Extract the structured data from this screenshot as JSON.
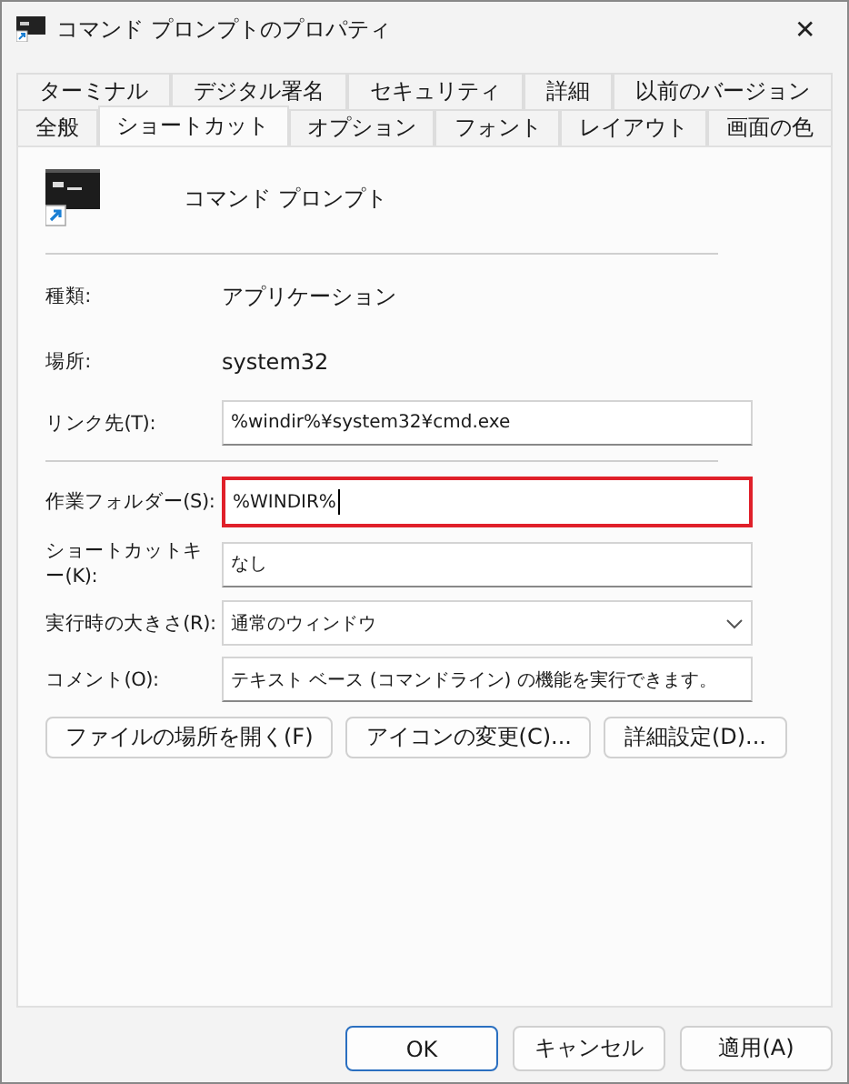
{
  "window": {
    "title": "コマンド プロンプトのプロパティ",
    "close": "✕"
  },
  "tab_rows": [
    [
      {
        "label": "ターミナル",
        "selected": false
      },
      {
        "label": "デジタル署名",
        "selected": false
      },
      {
        "label": "セキュリティ",
        "selected": false
      },
      {
        "label": "詳細",
        "selected": false
      },
      {
        "label": "以前のバージョン",
        "selected": false
      }
    ],
    [
      {
        "label": "全般",
        "selected": false
      },
      {
        "label": "ショートカット",
        "selected": true
      },
      {
        "label": "オプション",
        "selected": false
      },
      {
        "label": "フォント",
        "selected": false
      },
      {
        "label": "レイアウト",
        "selected": false
      },
      {
        "label": "画面の色",
        "selected": false
      }
    ]
  ],
  "shortcut_name": "コマンド プロンプト",
  "sections": [
    [
      {
        "kind": "info",
        "label": "種類:",
        "value": "アプリケーション"
      },
      {
        "kind": "info",
        "label": "場所:",
        "value": "system32"
      },
      {
        "kind": "text",
        "label": "リンク先(T):",
        "value": "%windir%¥system32¥cmd.exe",
        "focused": false
      }
    ],
    [
      {
        "kind": "text",
        "label": "作業フォルダー(S):",
        "value": "%WINDIR%",
        "focused": true
      },
      {
        "kind": "text",
        "label": "ショートカットキー(K):",
        "value": "なし",
        "focused": false
      },
      {
        "kind": "dropdown",
        "label": "実行時の大きさ(R):",
        "value": "通常のウィンドウ"
      },
      {
        "kind": "text",
        "label": "コメント(O):",
        "value": "テキスト ベース (コマンドライン) の機能を実行できます。",
        "focused": false
      }
    ]
  ],
  "action_buttons": [
    "ファイルの場所を開く(F)",
    "アイコンの変更(C)...",
    "詳細設定(D)..."
  ],
  "dialog_buttons": [
    {
      "label": "OK",
      "default": true
    },
    {
      "label": "キャンセル",
      "default": false
    },
    {
      "label": "適用(A)",
      "default": false
    }
  ]
}
